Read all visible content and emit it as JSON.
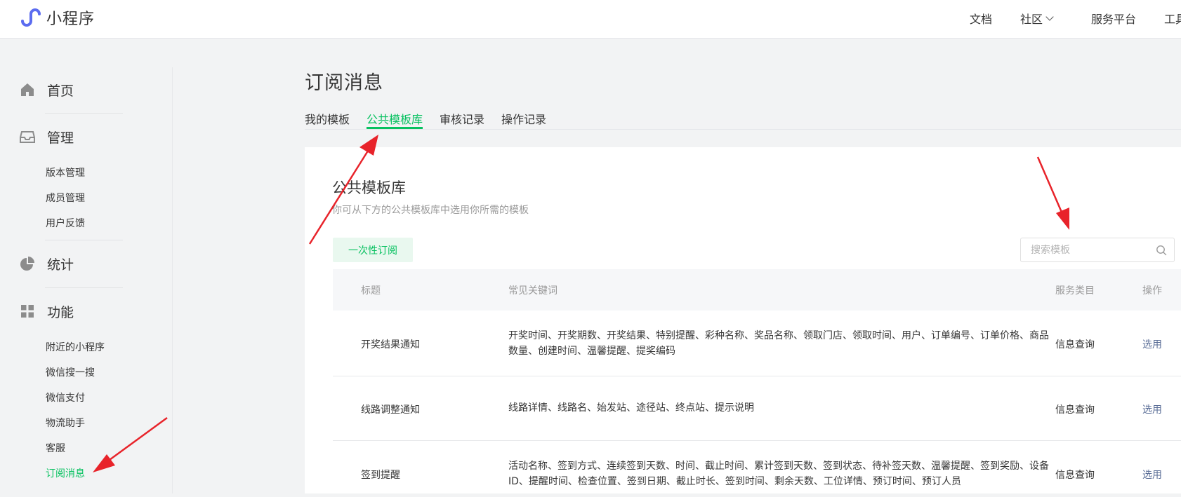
{
  "header": {
    "app_name": "小程序",
    "nav": [
      "文档",
      "社区",
      "服务平台",
      "工具"
    ]
  },
  "sidebar": {
    "sections": [
      {
        "label": "首页",
        "icon": "home-icon",
        "items": []
      },
      {
        "label": "管理",
        "icon": "inbox-icon",
        "items": [
          "版本管理",
          "成员管理",
          "用户反馈"
        ]
      },
      {
        "label": "统计",
        "icon": "pie-chart-icon",
        "items": []
      },
      {
        "label": "功能",
        "icon": "grid-icon",
        "items": [
          "附近的小程序",
          "微信搜一搜",
          "微信支付",
          "物流助手",
          "客服",
          "订阅消息"
        ]
      }
    ],
    "active_item": "订阅消息"
  },
  "main": {
    "title": "订阅消息",
    "tabs": [
      "我的模板",
      "公共模板库",
      "审核记录",
      "操作记录"
    ],
    "active_tab": "公共模板库",
    "panel": {
      "title": "公共模板库",
      "description": "你可从下方的公共模板库中选用你所需的模板",
      "filter_button": "一次性订阅",
      "search_placeholder": "搜索模板",
      "columns": [
        "标题",
        "常见关键词",
        "服务类目",
        "操作"
      ],
      "rows": [
        {
          "title": "开奖结果通知",
          "keywords": "开奖时间、开奖期数、开奖结果、特别提醒、彩种名称、奖品名称、领取门店、领取时间、用户、订单编号、订单价格、商品数量、创建时间、温馨提醒、提奖编码",
          "category": "信息查询",
          "action": "选用"
        },
        {
          "title": "线路调整通知",
          "keywords": "线路详情、线路名、始发站、途径站、终点站、提示说明",
          "category": "信息查询",
          "action": "选用"
        },
        {
          "title": "签到提醒",
          "keywords": "活动名称、签到方式、连续签到天数、时间、截止时间、累计签到天数、签到状态、待补签天数、温馨提醒、签到奖励、设备ID、提醒时间、检查位置、签到日期、截止时长、签到时间、剩余天数、工位详情、预订时间、预订人员",
          "category": "信息查询",
          "action": "选用"
        }
      ]
    }
  },
  "colors": {
    "accent": "#07c160",
    "link": "#576b95",
    "annotation_arrow": "#e8232a"
  }
}
